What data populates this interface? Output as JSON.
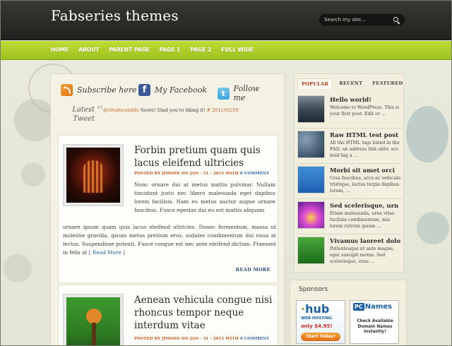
{
  "header": {
    "site_title": "Fabseries themes",
    "search_placeholder": "Search my site..."
  },
  "nav": {
    "items": [
      "HOME",
      "ABOUT",
      "PARENT PAGE",
      "PAGE 1",
      "PAGE 2",
      "FULL WIDE"
    ]
  },
  "social": {
    "subscribe": "Subscribe here",
    "facebook": "My Facebook",
    "twitter": "Follow me",
    "facebook_glyph": "f",
    "twitter_glyph": "t"
  },
  "tweet": {
    "title_line1": "Latest",
    "title_line2": "Tweet",
    "user": "@vitodecataldo",
    "text": " Score! Glad you're liking it! ",
    "date": "# 2011/02/10"
  },
  "posts": [
    {
      "title": "Forbin pretium quam quis lacus eleifend ultricies",
      "meta_prefix": "POSTED BY JIMSON ON JAN - 31 - 2011 WITH ",
      "meta_comments": "0 COMMENT",
      "excerpt_right": "Nunc ornare dui at metus mattis pulvinar. Nullam tincidunt justo nec libero malesuada eget dapibus lorem facilisis. Nam eu metus auctor augue ornare faucibus. Fusce egestas dui eu est mattis aliquam",
      "excerpt_full": "ornare ipsum quam quis lacus eleifend ultricies. Donec fermentum, massa ut molestie gravida, ipsum metus pretium eros, sodales condimentum dui risus at lectus. Suspendisse potenti. Fusce congue est nec ante eleifend dictum. Praesent in felis at ",
      "read_more_inline": "[ Read More ]",
      "read_more_button": "READ MORE"
    },
    {
      "title": "Aenean vehicula congue nisi rhoncus tempor neque interdum vitae",
      "meta_prefix": "POSTED BY JIMSON ON JAN - 31 - 2011 WITH ",
      "meta_comments": "0 COMMENT"
    }
  ],
  "sidebar": {
    "tabs": [
      "POPULAR",
      "RECENT",
      "FEATURED"
    ],
    "active_tab": "POPULAR",
    "popular": [
      {
        "title": "Hello world!",
        "excerpt": "Welcome to WordPress. This is your first post. Edit or ..."
      },
      {
        "title": "Raw HTML test post",
        "excerpt": "All the HTML tags listed in the FAQ: an address link abbr. acr. bold big a ..."
      },
      {
        "title": "Morbi sit amet orci",
        "excerpt": "Cras faucibus, arcu ac vehicula tristique, lectus turpis dapibus lorem, ..."
      },
      {
        "title": "Sed scelerisque, urn",
        "excerpt": "Etiam malesuada, urna vitae facilisis condimentum, nisi lorem rutrum ipsum ..."
      },
      {
        "title": "Vivamus laoreet dolo",
        "excerpt": "Pellentesque ut ante magna, eget suscipit metus. Sed scelerisque, urna ..."
      }
    ]
  },
  "sponsors": {
    "title": "Sponsors",
    "hub": {
      "logo_a": "∙",
      "logo_b": "hub",
      "sub": "WEB HOSTING",
      "price": "only $4.95!",
      "button": "Start Today!"
    },
    "pcnames": {
      "box": "PC",
      "name": "Names",
      "text": "Check Available Domain Names Instantly!"
    }
  }
}
